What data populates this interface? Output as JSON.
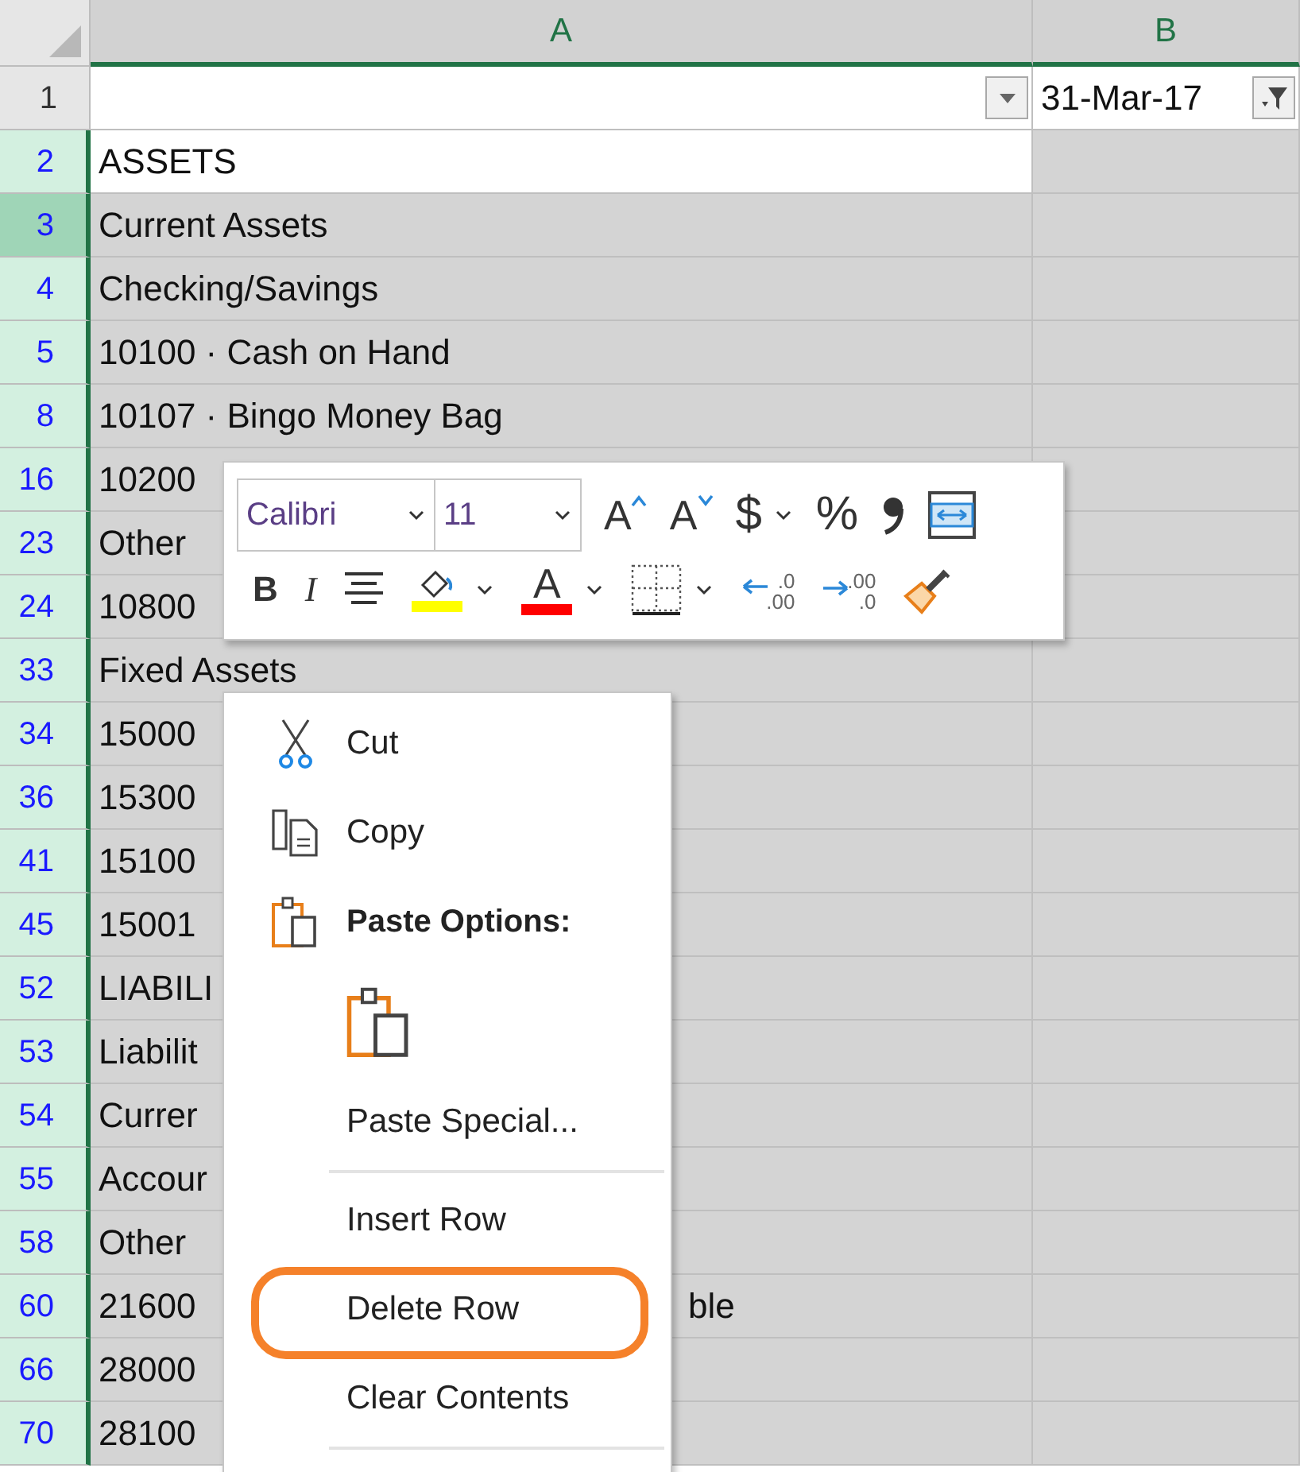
{
  "columns": [
    {
      "label": "A"
    },
    {
      "label": "B"
    }
  ],
  "rows": [
    {
      "number": "1",
      "cells": [
        "",
        "31-Mar-17"
      ],
      "filtered": false,
      "in_selection": false,
      "highlighted": false
    },
    {
      "number": "2",
      "cells": [
        "ASSETS",
        ""
      ],
      "filtered": true,
      "in_selection": true,
      "highlighted": false,
      "active": true
    },
    {
      "number": "3",
      "cells": [
        "Current Assets",
        ""
      ],
      "filtered": true,
      "in_selection": true,
      "highlighted": true
    },
    {
      "number": "4",
      "cells": [
        "Checking/Savings",
        ""
      ],
      "filtered": true,
      "in_selection": true,
      "highlighted": false
    },
    {
      "number": "5",
      "cells": [
        "10100 · Cash on Hand",
        ""
      ],
      "filtered": true,
      "in_selection": true,
      "highlighted": false
    },
    {
      "number": "8",
      "cells": [
        "10107 · Bingo Money Bag",
        ""
      ],
      "filtered": true,
      "in_selection": true,
      "highlighted": false
    },
    {
      "number": "16",
      "cells": [
        "10200",
        ""
      ],
      "filtered": true,
      "in_selection": true,
      "highlighted": false
    },
    {
      "number": "23",
      "cells": [
        "Other",
        ""
      ],
      "filtered": true,
      "in_selection": true,
      "highlighted": false
    },
    {
      "number": "24",
      "cells": [
        "10800",
        ""
      ],
      "filtered": true,
      "in_selection": true,
      "highlighted": false
    },
    {
      "number": "33",
      "cells": [
        "Fixed Assets",
        ""
      ],
      "filtered": true,
      "in_selection": true,
      "highlighted": false
    },
    {
      "number": "34",
      "cells": [
        "15000",
        ""
      ],
      "filtered": true,
      "in_selection": true,
      "highlighted": false
    },
    {
      "number": "36",
      "cells": [
        "15300",
        ""
      ],
      "filtered": true,
      "in_selection": true,
      "highlighted": false
    },
    {
      "number": "41",
      "cells": [
        "15100",
        ""
      ],
      "filtered": true,
      "in_selection": true,
      "highlighted": false
    },
    {
      "number": "45",
      "cells": [
        "15001",
        ""
      ],
      "filtered": true,
      "in_selection": true,
      "highlighted": false
    },
    {
      "number": "52",
      "cells": [
        "LIABILI",
        ""
      ],
      "filtered": true,
      "in_selection": true,
      "highlighted": false
    },
    {
      "number": "53",
      "cells": [
        "Liabilit",
        ""
      ],
      "filtered": true,
      "in_selection": true,
      "highlighted": false
    },
    {
      "number": "54",
      "cells": [
        "Currer",
        ""
      ],
      "filtered": true,
      "in_selection": true,
      "highlighted": false
    },
    {
      "number": "55",
      "cells": [
        "Accour",
        ""
      ],
      "filtered": true,
      "in_selection": true,
      "highlighted": false
    },
    {
      "number": "58",
      "cells": [
        "Other",
        ""
      ],
      "filtered": true,
      "in_selection": true,
      "highlighted": false
    },
    {
      "number": "60",
      "cells": [
        "21600",
        ""
      ],
      "overflow_tail": "ble",
      "filtered": true,
      "in_selection": true,
      "highlighted": false
    },
    {
      "number": "66",
      "cells": [
        "28000",
        ""
      ],
      "filtered": true,
      "in_selection": true,
      "highlighted": false
    },
    {
      "number": "70",
      "cells": [
        "28100",
        ""
      ],
      "filtered": true,
      "in_selection": true,
      "highlighted": false
    }
  ],
  "mini_toolbar": {
    "font": {
      "value": "Calibri"
    },
    "size": {
      "value": "11"
    },
    "row_1": [
      {
        "kind": "grow_font",
        "glyph": "A",
        "dropdown": false
      },
      {
        "kind": "shrink_font",
        "glyph": "A",
        "dropdown": false
      },
      {
        "kind": "currency",
        "glyph": "$",
        "dropdown": true
      },
      {
        "kind": "percent",
        "glyph": "%",
        "dropdown": false
      },
      {
        "kind": "comma",
        "dropdown": false
      },
      {
        "kind": "wrap",
        "dropdown": false
      }
    ],
    "row_2": [
      {
        "kind": "bold",
        "glyph": "B",
        "dropdown": false
      },
      {
        "kind": "italic",
        "glyph": "I",
        "dropdown": false
      },
      {
        "kind": "center",
        "dropdown": false
      },
      {
        "kind": "fill_color",
        "color": "#ffff00",
        "dropdown": true
      },
      {
        "kind": "font_color",
        "glyph": "A",
        "color": "#ff0000",
        "dropdown": true
      },
      {
        "kind": "borders",
        "dropdown": true
      },
      {
        "kind": "increase_decimal",
        "glyph_top": ".0",
        "glyph_bottom": ".00",
        "dropdown": false
      },
      {
        "kind": "decrease_decimal",
        "glyph_top": ".00",
        "glyph_bottom": ".0",
        "dropdown": false
      },
      {
        "kind": "format_painter",
        "dropdown": false
      }
    ]
  },
  "context_menu": [
    {
      "kind": "command",
      "label": "Cut",
      "annotated": false
    },
    {
      "kind": "command",
      "label": "Copy",
      "annotated": false
    },
    {
      "kind": "header",
      "label": "Paste Options:"
    },
    {
      "kind": "paste_option"
    },
    {
      "kind": "command",
      "label": "Paste Special...",
      "annotated": false
    },
    {
      "kind": "separator"
    },
    {
      "kind": "command",
      "label": "Insert Row",
      "annotated": false
    },
    {
      "kind": "command",
      "label": "Delete Row",
      "annotated": true
    },
    {
      "kind": "command",
      "label": "Clear Contents",
      "annotated": false
    },
    {
      "kind": "separator"
    }
  ]
}
